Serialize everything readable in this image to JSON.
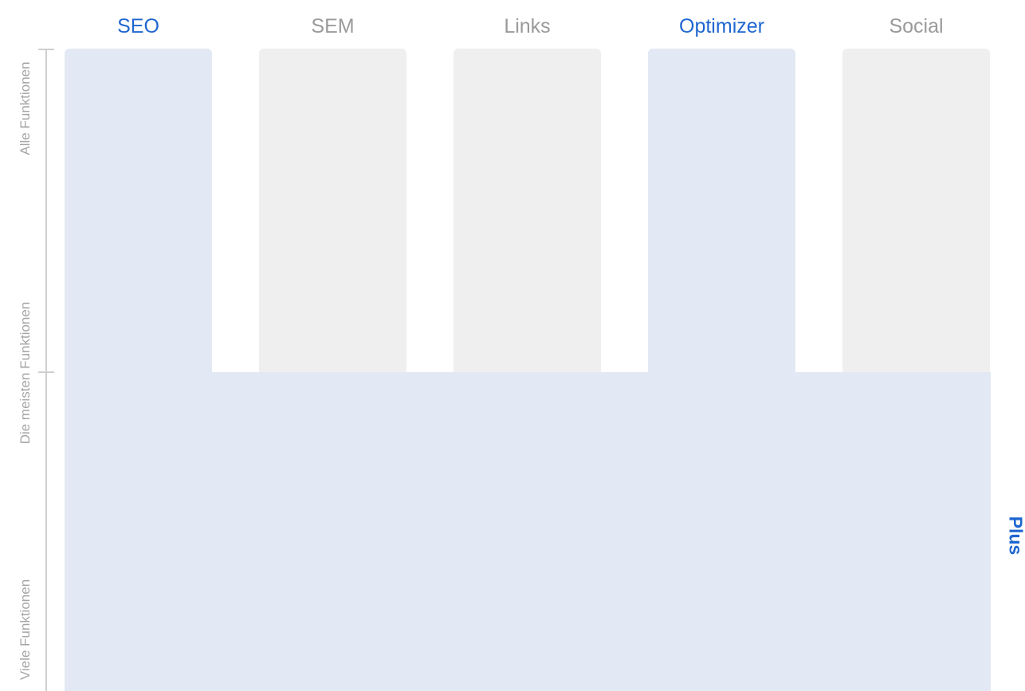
{
  "tabs": [
    {
      "label": "SEO",
      "active": true
    },
    {
      "label": "SEM",
      "active": false
    },
    {
      "label": "Links",
      "active": false
    },
    {
      "label": "Optimizer",
      "active": true
    },
    {
      "label": "Social",
      "active": false
    }
  ],
  "tiers": {
    "top": "Alle Funktionen",
    "middle": "Die meisten Funktionen",
    "bottom": "Viele Funktionen"
  },
  "plan_label": "Plus",
  "colors": {
    "accent": "#1f66d0",
    "inactive_text": "#9a9a9a",
    "active_fill": "#e2e9f4",
    "inactive_fill": "#efefef",
    "axis": "#cfcfcf"
  }
}
